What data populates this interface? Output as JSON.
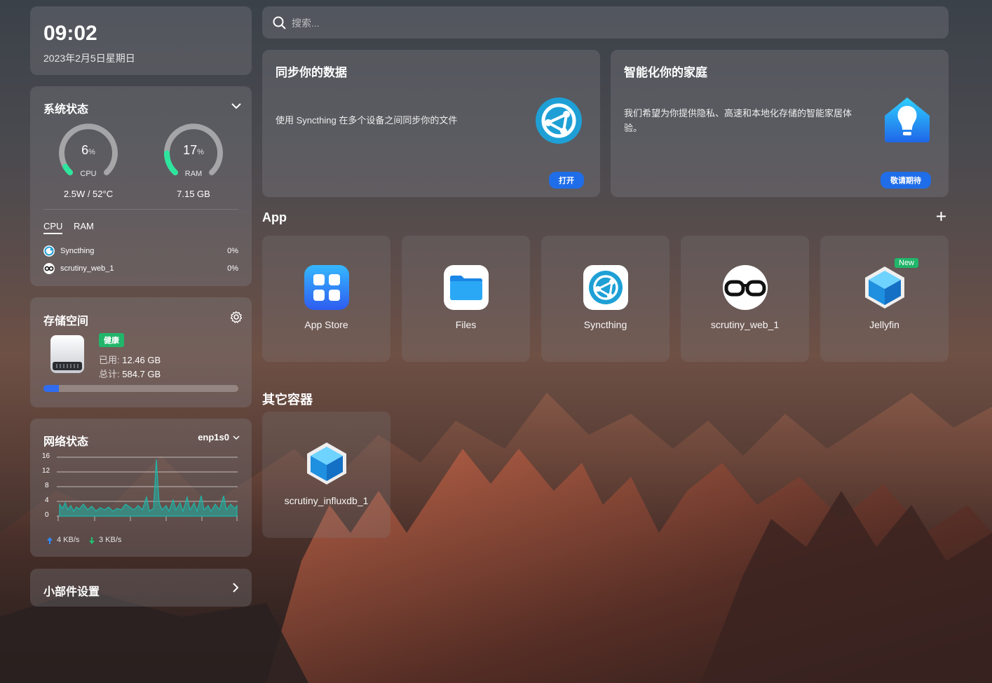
{
  "clock": {
    "time": "09:02",
    "date": "2023年2月5日星期日"
  },
  "system_status": {
    "title": "系统状态",
    "cpu": {
      "percent": 6,
      "percent_text": "6",
      "unit": "%",
      "label": "CPU",
      "sub": "2.5W / 52°C"
    },
    "ram": {
      "percent": 17,
      "percent_text": "17",
      "unit": "%",
      "label": "RAM",
      "sub": "7.15 GB"
    },
    "tabs": [
      "CPU",
      "RAM"
    ],
    "processes": [
      {
        "name": "Syncthing",
        "value": "0%",
        "icon": "syncthing-icon"
      },
      {
        "name": "scrutiny_web_1",
        "value": "0%",
        "icon": "glasses-icon"
      }
    ]
  },
  "storage": {
    "title": "存储空间",
    "status": "健康",
    "used_label": "已用:",
    "used_value": "12.46 GB",
    "total_label": "总计:",
    "total_value": "584.7 GB",
    "used_fraction": 0.021
  },
  "network": {
    "title": "网络状态",
    "interface": "enp1s0",
    "y_ticks": [
      "16",
      "12",
      "8",
      "4",
      "0"
    ],
    "upload": "4 KB/s",
    "download": "3 KB/s"
  },
  "widget_settings": {
    "label": "小部件设置"
  },
  "search": {
    "placeholder": "搜索..."
  },
  "features": [
    {
      "title": "同步你的数据",
      "desc": "使用 Syncthing 在多个设备之间同步你的文件",
      "button": "打开",
      "icon": "syncthing-icon"
    },
    {
      "title": "智能化你的家庭",
      "desc": "我们希望为你提供隐私、高速和本地化存储的智能家居体验。",
      "button": "敬请期待",
      "icon": "smart-home-icon"
    }
  ],
  "apps": {
    "title": "App",
    "items": [
      {
        "name": "App Store",
        "icon": "app-store-icon"
      },
      {
        "name": "Files",
        "icon": "files-icon"
      },
      {
        "name": "Syncthing",
        "icon": "syncthing-icon"
      },
      {
        "name": "scrutiny_web_1",
        "icon": "glasses-icon"
      },
      {
        "name": "Jellyfin",
        "icon": "cube-icon",
        "badge": "New"
      }
    ]
  },
  "other_containers": {
    "title": "其它容器",
    "items": [
      {
        "name": "scrutiny_influxdb_1",
        "icon": "cube-icon"
      }
    ]
  },
  "colors": {
    "accent_blue": "#1f6de8",
    "healthy_green": "#21b66a",
    "gauge_green": "#2ee59d",
    "chart_teal": "#1fb5a8"
  }
}
